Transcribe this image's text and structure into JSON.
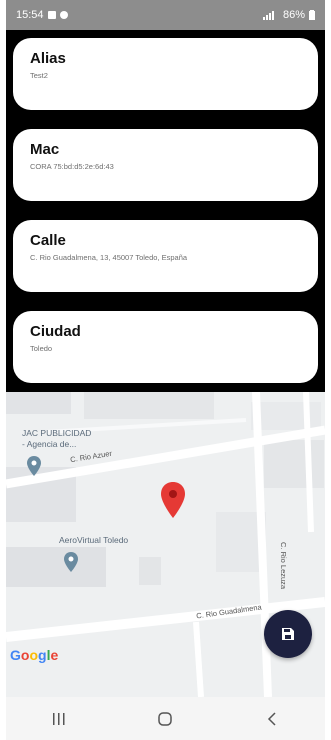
{
  "status_bar": {
    "time": "15:54",
    "battery": "86%"
  },
  "cards": [
    {
      "label": "Alias",
      "value": "Test2"
    },
    {
      "label": "Mac",
      "value": "CORA 75:bd:d5:2e:6d:43"
    },
    {
      "label": "Calle",
      "value": "C. Rio Guadalmena, 13, 45007 Toledo, España"
    },
    {
      "label": "Ciudad",
      "value": "Toledo"
    }
  ],
  "map": {
    "places": [
      {
        "name_line1": "JAC PUBLICIDAD",
        "name_line2": "- Agencia de..."
      },
      {
        "name": "AeroVirtual Toledo"
      }
    ],
    "roads": {
      "azuer": "C. Rio Azuer",
      "guadalmena": "C. Rio Guadalmena",
      "lezuza": "C. Rio Lezuza"
    },
    "attribution": "Google",
    "pin_color": "#e53935"
  },
  "fab": {
    "icon": "save-icon",
    "color": "#1d2140"
  },
  "nav": {
    "recents": "recents-icon",
    "home": "home-icon",
    "back": "back-icon"
  }
}
